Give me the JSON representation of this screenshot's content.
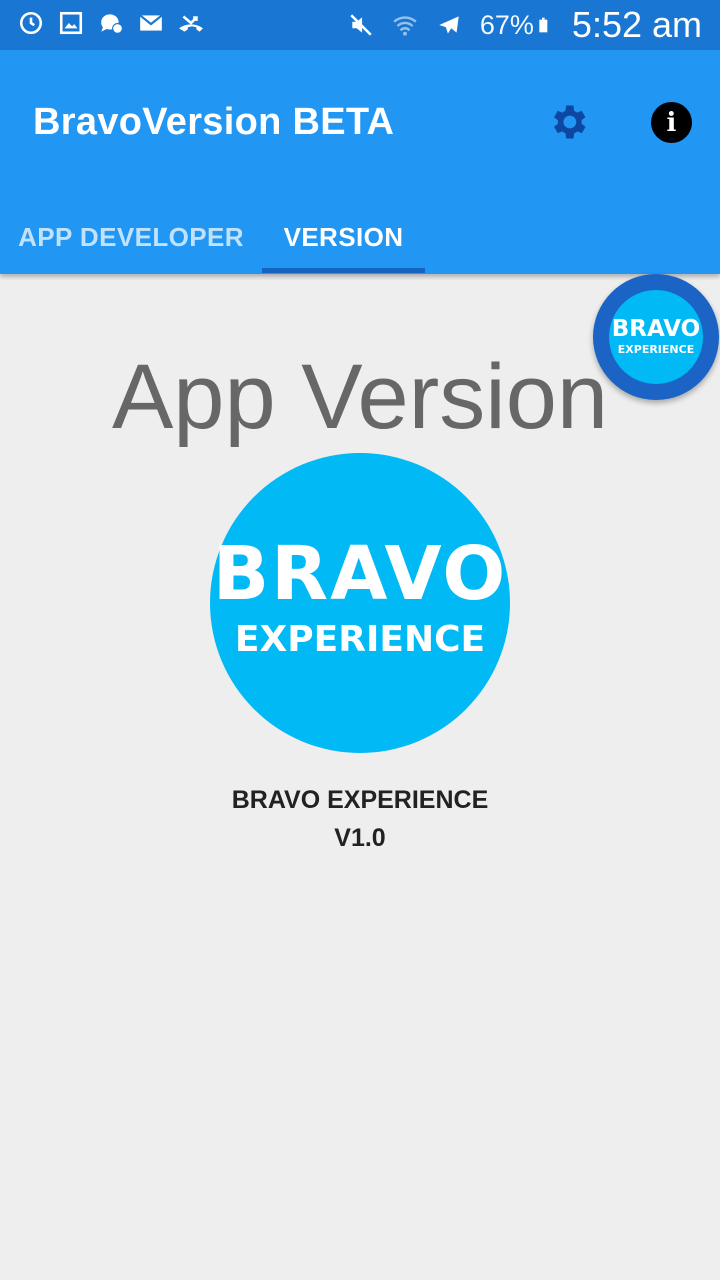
{
  "status_bar": {
    "left_icons": [
      "sync-icon",
      "image-icon",
      "chat-bubble-icon",
      "mail-icon",
      "missed-call-icon"
    ],
    "right_icons": [
      "mute-icon",
      "wifi-icon",
      "airplane-icon",
      "battery-icon"
    ],
    "battery": "67%",
    "time": "5:52 am"
  },
  "app_bar": {
    "title": "BravoVersion BETA",
    "settings_icon": "gear-icon",
    "info_icon": "info-icon",
    "info_glyph": "i"
  },
  "tabs": [
    {
      "label": "APP DEVELOPER",
      "selected": false
    },
    {
      "label": "VERSION",
      "selected": true
    }
  ],
  "content": {
    "heading": "App Version",
    "logo": {
      "line1": "BRAVO",
      "line2": "EXPERIENCE"
    },
    "app_name": "BRAVO EXPERIENCE",
    "version": "V1.0"
  },
  "floating_bubble": {
    "line1": "BRAVO",
    "line2": "EXPERIENCE"
  },
  "colors": {
    "status_bar": "#1976d2",
    "app_bar": "#2196f3",
    "tab_indicator": "#1565c0",
    "logo": "#00b9f5",
    "bubble_ring": "#1b63c4",
    "background": "#eeeeee"
  }
}
